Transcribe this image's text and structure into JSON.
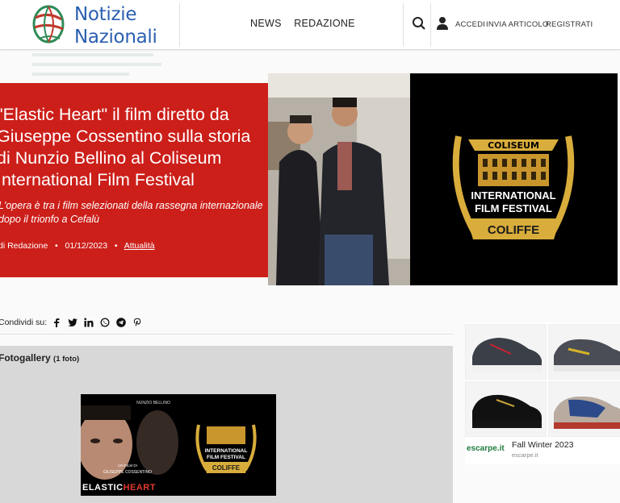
{
  "header": {
    "logo_line1": "Notizie",
    "logo_line2": "Nazionali",
    "nav": [
      "NEWS",
      "REDAZIONE"
    ],
    "auth": [
      "ACCEDI",
      "INVIA ARTICOLO",
      "REGISTRATI"
    ]
  },
  "hero": {
    "title": "\"Elastic Heart\" il film diretto da Giuseppe Cossentino sulla storia di Nunzio Bellino al Coliseum International Film Festival",
    "subtitle": "L'opera è tra i film selezionati della rassegna internazionale dopo il trionfo a Cefalù",
    "author": "di Redazione",
    "date": "01/12/2023",
    "category": "Attualità",
    "image_text": {
      "coliseum": "COLISEUM",
      "festival_line1": "INTERNATIONAL",
      "festival_line2": "FILM FESTIVAL",
      "ribbon": "COLIFFE"
    }
  },
  "share": {
    "label": "Condividi su:",
    "icons": [
      "facebook-icon",
      "twitter-icon",
      "linkedin-icon",
      "whatsapp-icon",
      "telegram-icon",
      "pinterest-icon"
    ]
  },
  "gallery": {
    "title": "Fotogallery",
    "count": "(1 foto)",
    "thumb_text": {
      "actor": "NUNZIO BELLINO",
      "director_line1": "UN FILM DI",
      "director_line2": "GIUSEPPE COSSENTINO",
      "film_part1": "ELASTIC",
      "film_part2": "HEART",
      "festival_line1": "INTERNATIONAL",
      "festival_line2": "FILM FESTIVAL",
      "ribbon": "COLIFFE"
    }
  },
  "ad": {
    "brand": "escarpe.it",
    "title": "Fall Winter 2023",
    "url": "escarpe.it"
  },
  "colors": {
    "brand_blue": "#2a5fb0",
    "hero_red": "#cc1f1a",
    "gold": "#d9ad3b"
  }
}
